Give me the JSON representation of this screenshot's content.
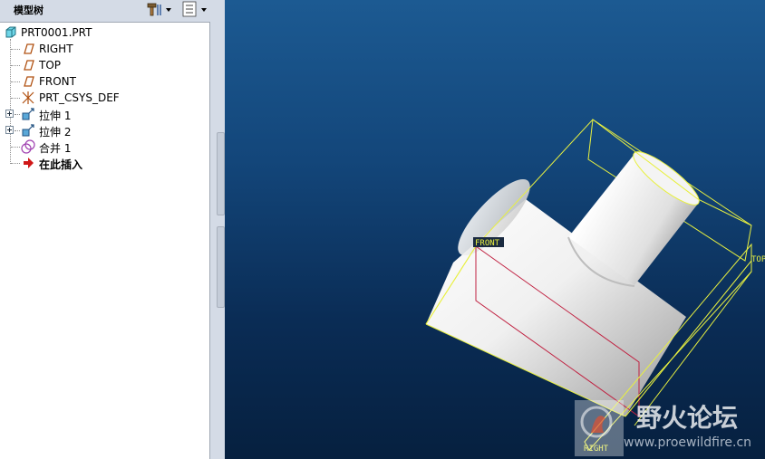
{
  "panel": {
    "title": "模型树"
  },
  "tree": {
    "root": "PRT0001.PRT",
    "items": [
      {
        "label": "RIGHT",
        "icon": "datum-plane-icon",
        "expandable": false
      },
      {
        "label": "TOP",
        "icon": "datum-plane-icon",
        "expandable": false
      },
      {
        "label": "FRONT",
        "icon": "datum-plane-icon",
        "expandable": false
      },
      {
        "label": "PRT_CSYS_DEF",
        "icon": "coordinate-system-icon",
        "expandable": false
      },
      {
        "label": "拉伸 1",
        "icon": "extrude-icon",
        "expandable": true
      },
      {
        "label": "拉伸 2",
        "icon": "extrude-icon",
        "expandable": true
      },
      {
        "label": "合并 1",
        "icon": "merge-icon",
        "expandable": false
      },
      {
        "label": "在此插入",
        "icon": "insert-here-arrow-icon",
        "expandable": false
      }
    ]
  },
  "viewport": {
    "datum_labels": {
      "front": "FRONT",
      "top": "TOP",
      "right": "RIGHT"
    },
    "background_top": "#1c5a92",
    "background_bottom": "#06203f",
    "datum_color": "#e8f040"
  },
  "watermark": {
    "title": "野火论坛",
    "url": "www.proewildfire.cn"
  }
}
